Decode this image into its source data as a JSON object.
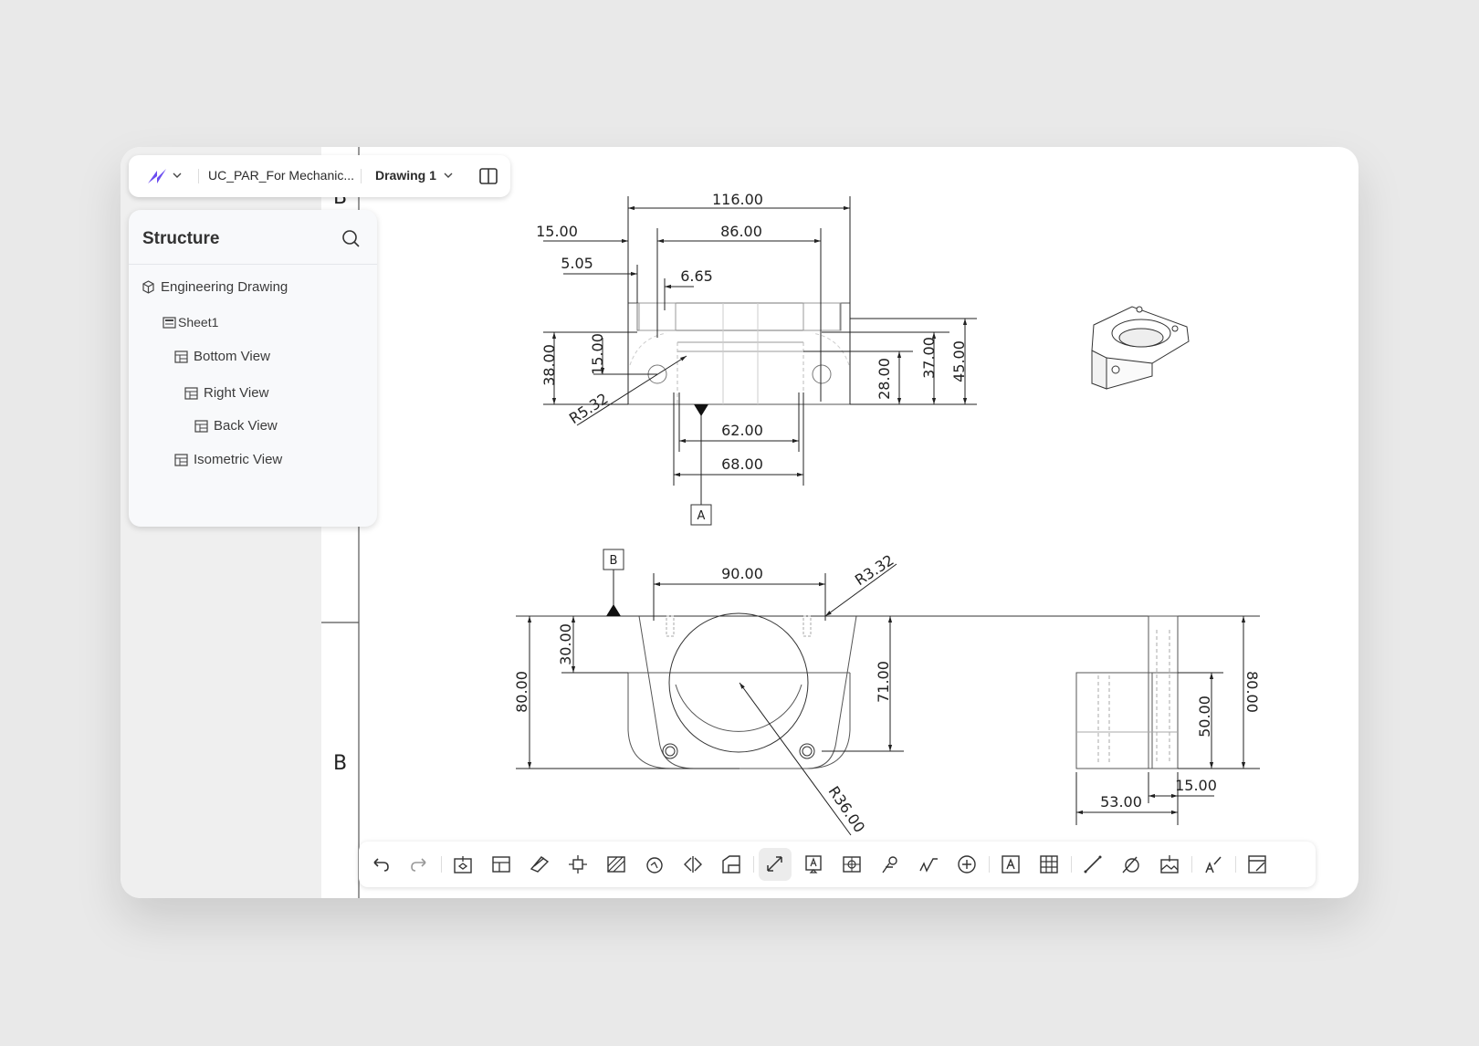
{
  "header": {
    "file_name": "UC_PAR_For Mechanic...",
    "drawing_name": "Drawing 1"
  },
  "structure": {
    "title": "Structure",
    "items": [
      {
        "label": "Engineering Drawing",
        "icon": "cube-icon"
      },
      {
        "label": "Sheet1",
        "icon": "sheet-icon"
      },
      {
        "label": "Bottom View",
        "icon": "view-icon"
      },
      {
        "label": "Right View",
        "icon": "view-icon"
      },
      {
        "label": "Back View",
        "icon": "view-icon"
      },
      {
        "label": "Isometric View",
        "icon": "view-icon"
      }
    ]
  },
  "drawing": {
    "border_zone_labels": [
      "B",
      "B"
    ],
    "datums": [
      "A",
      "B"
    ],
    "top_view": {
      "dims": [
        "116.00",
        "15.00",
        "86.00",
        "5.05",
        "6.65",
        "38.00",
        "15.00",
        "R5.32",
        "62.00",
        "68.00",
        "28.00",
        "37.00",
        "45.00"
      ]
    },
    "front_view": {
      "dims": [
        "90.00",
        "R3.32",
        "30.00",
        "80.00",
        "71.00",
        "R36.00"
      ]
    },
    "side_view": {
      "dims": [
        "80.00",
        "50.00",
        "15.00",
        "53.00"
      ]
    }
  },
  "toolbar": {
    "tools": [
      "undo-icon",
      "redo-icon",
      "base-view-icon",
      "projected-view-icon",
      "section-view-icon",
      "detail-view-icon",
      "hatch-icon",
      "break-view-icon",
      "mirror-view-icon",
      "crop-view-icon",
      "dimension-icon",
      "note-icon",
      "center-mark-icon",
      "weld-symbol-icon",
      "surface-finish-icon",
      "datum-icon",
      "text-icon",
      "table-icon",
      "line-icon",
      "arc-icon",
      "insert-image-icon",
      "format-painter-icon",
      "sheet-edit-icon"
    ],
    "active_tool": "dimension-icon"
  }
}
